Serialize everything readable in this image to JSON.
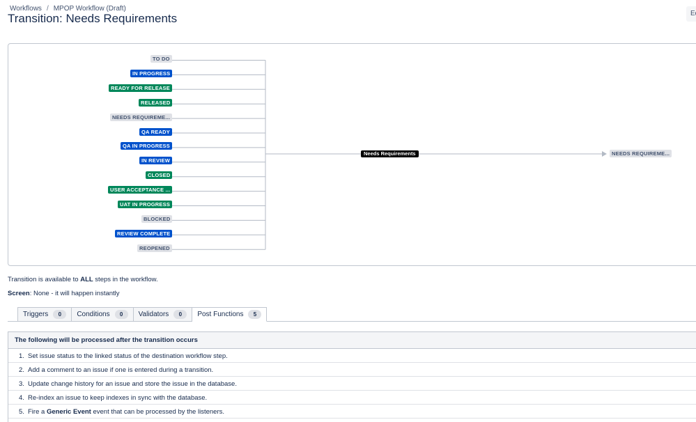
{
  "breadcrumb": {
    "root": "Workflows",
    "current": "MPOP Workflow (Draft)"
  },
  "page_title": "Transition: Needs Requirements",
  "edit_button": "Ed",
  "diagram": {
    "source_statuses": [
      {
        "label": "TO DO",
        "color": "gray"
      },
      {
        "label": "IN PROGRESS",
        "color": "blue"
      },
      {
        "label": "READY FOR RELEASE",
        "color": "green"
      },
      {
        "label": "RELEASED",
        "color": "green"
      },
      {
        "label": "NEEDS REQUIREME...",
        "color": "gray"
      },
      {
        "label": "QA READY",
        "color": "blue"
      },
      {
        "label": "QA IN PROGRESS",
        "color": "blue"
      },
      {
        "label": "IN REVIEW",
        "color": "blue"
      },
      {
        "label": "CLOSED",
        "color": "green"
      },
      {
        "label": "USER ACCEPTANCE ...",
        "color": "green"
      },
      {
        "label": "UAT IN PROGRESS",
        "color": "green"
      },
      {
        "label": "BLOCKED",
        "color": "gray"
      },
      {
        "label": "REVIEW COMPLETE",
        "color": "blue"
      },
      {
        "label": "REOPENED",
        "color": "gray"
      }
    ],
    "transition_label": "Needs Requirements",
    "target_status": {
      "label": "NEEDS REQUIREME...",
      "color": "gray"
    },
    "colors": {
      "gray": "#dfe1e6",
      "blue": "#0052cc",
      "green": "#00875a"
    }
  },
  "info": {
    "availability_prefix": "Transition is available to ",
    "availability_strong": "ALL",
    "availability_suffix": " steps in the workflow.",
    "screen_label": "Screen",
    "screen_value": ": None - it will happen instantly"
  },
  "tabs": [
    {
      "label": "Triggers",
      "count": "0"
    },
    {
      "label": "Conditions",
      "count": "0"
    },
    {
      "label": "Validators",
      "count": "0"
    },
    {
      "label": "Post Functions",
      "count": "5"
    }
  ],
  "post_functions": {
    "header": "The following will be processed after the transition occurs",
    "items": [
      {
        "num": "1.",
        "text": "Set issue status to the linked status of the destination workflow step."
      },
      {
        "num": "2.",
        "text": "Add a comment to an issue if one is entered during a transition."
      },
      {
        "num": "3.",
        "text": "Update change history for an issue and store the issue in the database."
      },
      {
        "num": "4.",
        "text": "Re-index an issue to keep indexes in sync with the database."
      },
      {
        "num": "5.",
        "text_pre": "Fire a ",
        "text_strong": "Generic Event",
        "text_post": " event that can be processed by the listeners."
      }
    ]
  }
}
